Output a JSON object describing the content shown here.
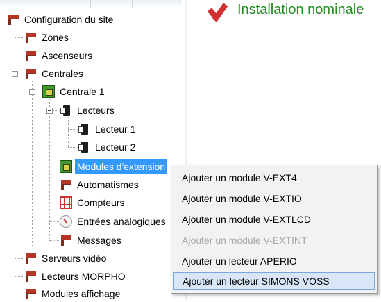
{
  "tree": {
    "root": "Configuration du site",
    "zones": "Zones",
    "ascenseurs": "Ascenseurs",
    "centrales": "Centrales",
    "centrale1": "Centrale 1",
    "lecteurs": "Lecteurs",
    "lecteur1": "Lecteur 1",
    "lecteur2": "Lecteur 2",
    "modules": "Modules d'extension",
    "automatismes": "Automatismes",
    "compteurs": "Compteurs",
    "entrees": "Entrées analogiques",
    "messages": "Messages",
    "serveurs": "Serveurs vidéo",
    "morpho": "Lecteurs MORPHO",
    "affichage": "Modules affichage"
  },
  "status": {
    "text": "Installation nominale",
    "color": "#1f8e1f"
  },
  "context_menu": {
    "items": [
      "Ajouter un module V-EXT4",
      "Ajouter un module V-EXTIO",
      "Ajouter un module V-EXTLCD",
      "Ajouter un module V-EXTINT",
      "Ajouter un lecteur APERIO",
      "Ajouter un lecteur SIMONS VOSS"
    ],
    "disabled_item": "Ajouter un module V-EXTINT",
    "hovered_item": "Ajouter un lecteur SIMONS VOSS"
  },
  "colors": {
    "selection": "#3399ff",
    "menu_hover": "#d9e6f7"
  }
}
